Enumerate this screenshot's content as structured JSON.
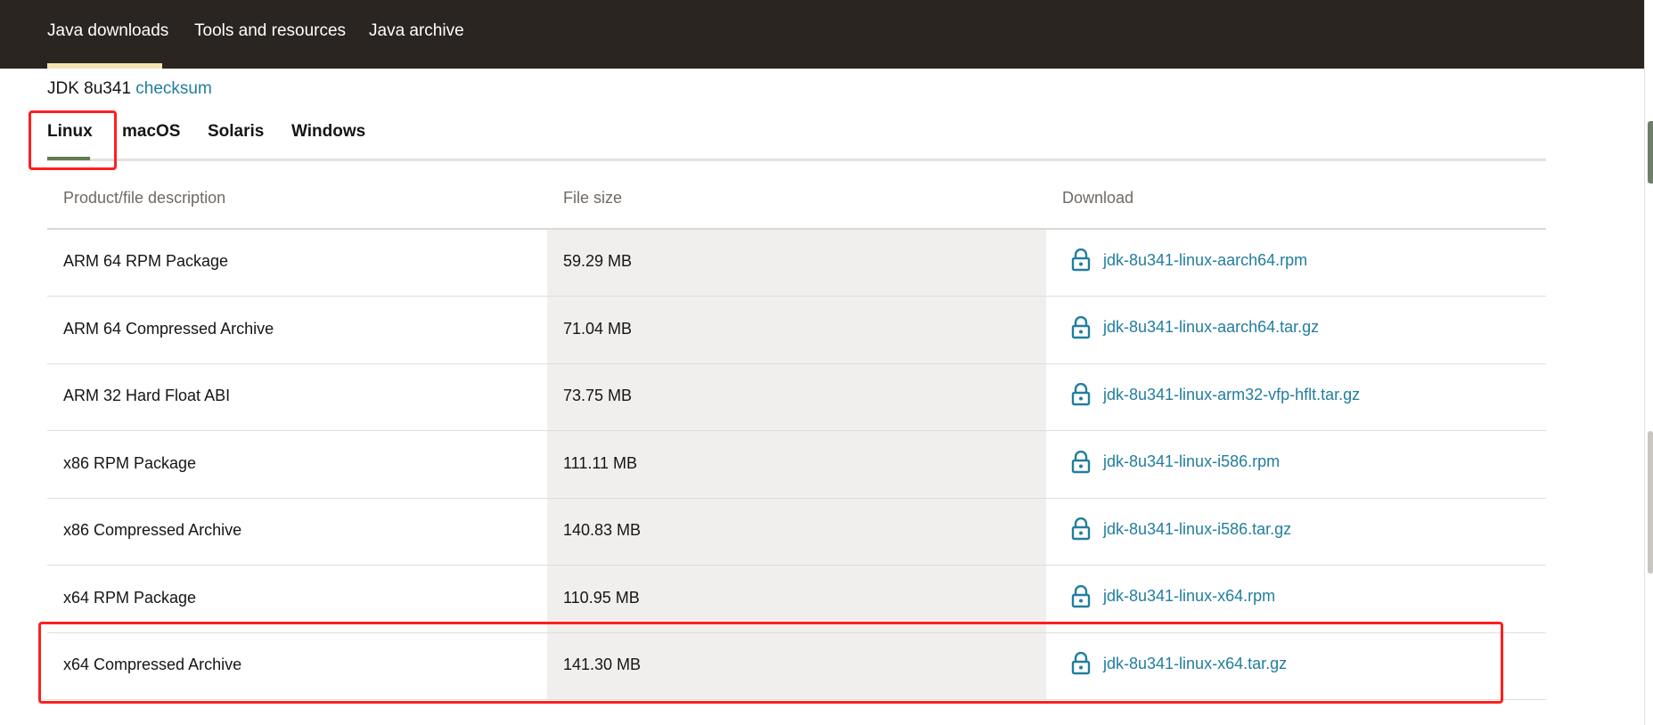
{
  "nav": {
    "items": [
      "Java downloads",
      "Tools and resources",
      "Java archive"
    ],
    "active_index": 0
  },
  "jdk": {
    "version": "JDK 8u341",
    "checksum_link": "checksum"
  },
  "tabs": {
    "items": [
      "Linux",
      "macOS",
      "Solaris",
      "Windows"
    ],
    "active_index": 0
  },
  "table": {
    "headers": [
      "Product/file description",
      "File size",
      "Download"
    ],
    "rows": [
      {
        "description": "ARM 64 RPM Package",
        "size": "59.29 MB",
        "file": "jdk-8u341-linux-aarch64.rpm"
      },
      {
        "description": "ARM 64 Compressed Archive",
        "size": "71.04 MB",
        "file": "jdk-8u341-linux-aarch64.tar.gz"
      },
      {
        "description": "ARM 32 Hard Float ABI",
        "size": "73.75 MB",
        "file": "jdk-8u341-linux-arm32-vfp-hflt.tar.gz"
      },
      {
        "description": "x86 RPM Package",
        "size": "111.11 MB",
        "file": "jdk-8u341-linux-i586.rpm"
      },
      {
        "description": "x86 Compressed Archive",
        "size": "140.83 MB",
        "file": "jdk-8u341-linux-i586.tar.gz"
      },
      {
        "description": "x64 RPM Package",
        "size": "110.95 MB",
        "file": "jdk-8u341-linux-x64.rpm"
      },
      {
        "description": "x64 Compressed Archive",
        "size": "141.30 MB",
        "file": "jdk-8u341-linux-x64.tar.gz"
      }
    ],
    "download_icon": "lock-icon"
  },
  "colors": {
    "nav_bg": "#2a2521",
    "link": "#227e9e",
    "tab_active": "#5f7d4f",
    "highlight": "#ff1f1f"
  }
}
